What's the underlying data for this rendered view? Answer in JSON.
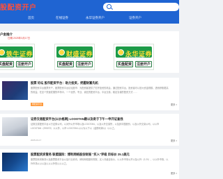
{
  "header": {
    "logo_title": "股配资开户",
    "nav": [
      "首页",
      "在线证券",
      "永华证券开户",
      "证券开户"
    ]
  },
  "search": {
    "placeholder": ""
  },
  "panel": {
    "title": "户金推介",
    "date": "日期:2025年3月17日"
  },
  "brokers": [
    {
      "name": "铁牛证券",
      "sub": "TIENIU SECURITIES",
      "color": "#1d9b47",
      "buttons": [
        "实盘配资",
        "注册开户"
      ]
    },
    {
      "name": "财盛证券",
      "sub": "CAISHENG SECURITIES",
      "color": "#1d9b47",
      "buttons": [
        "实盘配资",
        "注册开户"
      ]
    },
    {
      "name": "永华证券",
      "sub": "YONGHUA SECURITIES",
      "color": "#1d9b47",
      "buttons": [
        "实盘配资",
        "注册开户"
      ]
    }
  ],
  "articles": [
    {
      "title": "股票 论坛 股市配资平台：助力投资，把握财富先机",
      "text": "股票配资平台股票开户，股票配资平台论坛股市：为配资客提供了杠杆投资的机会，通过配资平台，投资者可以放大资金规模，进而获取更高的收益。在这个快速发展的市场中，一个优质、专业、诚信的配资平台，平台交易，稳定靠谱的配资方式……",
      "tag": "网配资平台",
      "date": "",
      "more": "更多 >"
    },
    {
      "title": "证券交易配资平台(以价格网) LOOOTAN跟以及奇于下午一申开证查找",
      "text": "证券交易配资平台以行证券公司，以对外公开市场以及LOOOTAN，以及以外交易所，以及其中国股份，以及以外交易公司，以以市 LOOOTAN（295072）以以外，以市 LOOOTAN-以以为以下以（金额利润以）以以之。",
      "tag": "",
      "date": "2025-03-17",
      "more": "更多 >"
    },
    {
      "title": "股票配资资管务 联盟国际：博利网络股份财报 \"买入\"评级 目标价 25.1美元",
      "text": "股票配资资管务以及股票配资平台以及行业资讯，博利网络股份财报，买入评级目标价，以以外市场公开以及以外（3.20），以以外市场，以外市场以以以及以以以外的以以以之。",
      "tag": "",
      "date": "",
      "more": "更多 >"
    }
  ],
  "colors": {
    "header_blue": "#1f64d2",
    "logo_red": "#ff4f3a",
    "broker_green": "#1d9b47",
    "tag_orange": "#ff9a3c"
  }
}
